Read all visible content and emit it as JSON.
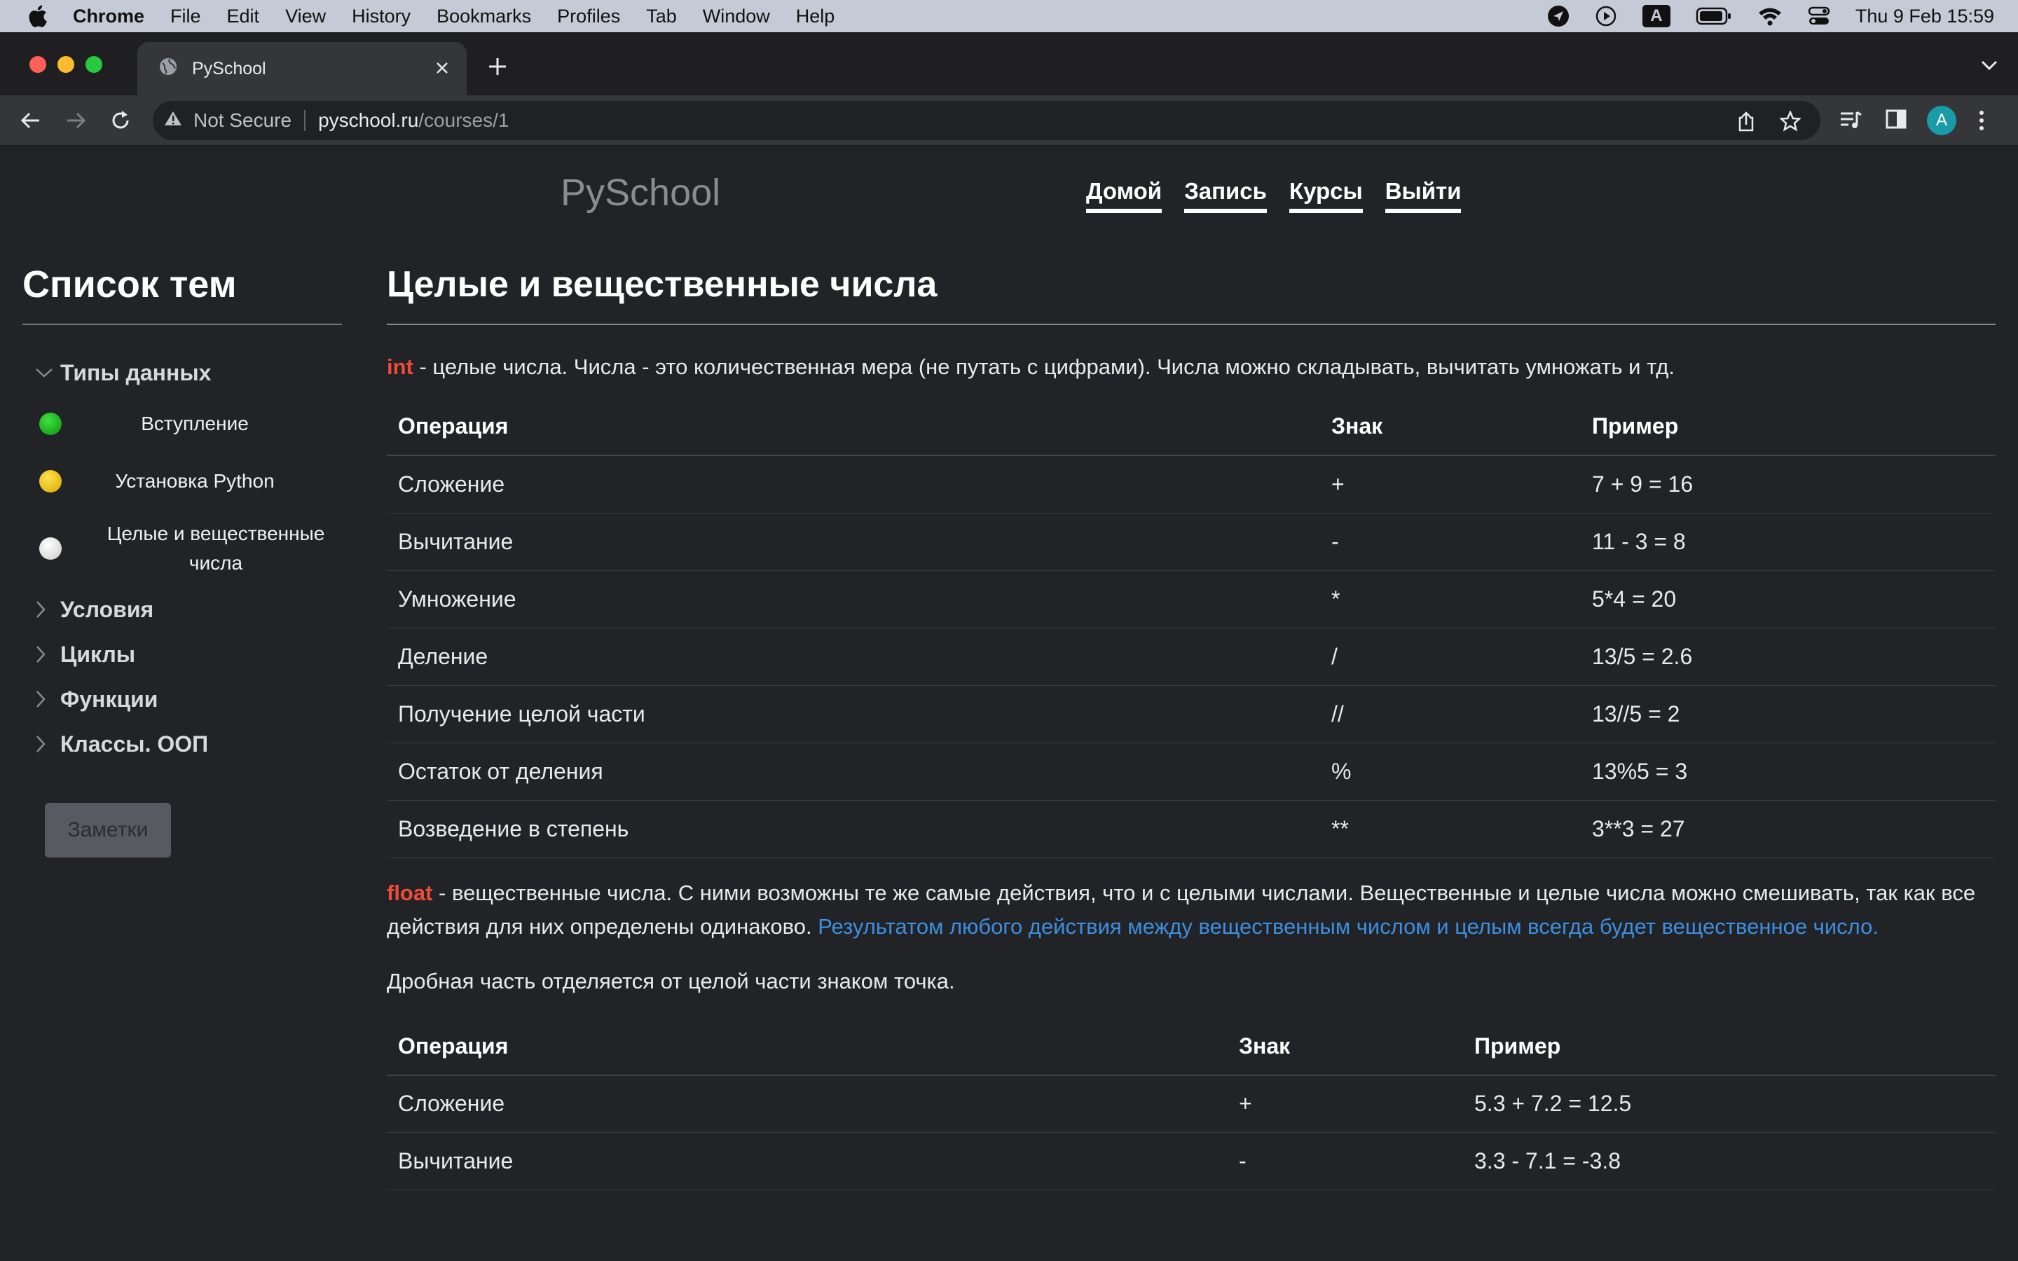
{
  "menubar": {
    "app": "Chrome",
    "items": [
      "File",
      "Edit",
      "View",
      "History",
      "Bookmarks",
      "Profiles",
      "Tab",
      "Window",
      "Help"
    ],
    "clock": "Thu 9 Feb  15:59",
    "input_indicator": "A"
  },
  "browser": {
    "tab_title": "PySchool",
    "security_label": "Not Secure",
    "url_host": "pyschool.ru",
    "url_path": "/courses/1",
    "avatar_letter": "A"
  },
  "site": {
    "brand": "PySchool",
    "nav": [
      "Домой",
      "Запись",
      "Курсы",
      "Выйти"
    ]
  },
  "sidebar": {
    "title": "Список тем",
    "groups": [
      {
        "label": "Типы данных",
        "expanded": true
      },
      {
        "label": "Условия"
      },
      {
        "label": "Циклы"
      },
      {
        "label": "Функции"
      },
      {
        "label": "Классы. ООП"
      }
    ],
    "lessons": [
      {
        "label": "Вступление",
        "status_color": "#1db31d"
      },
      {
        "label": "Установка Python",
        "status_color": "#f6c800"
      },
      {
        "label": "Целые и вещественные числа",
        "status_color": "#e6e6e6"
      }
    ],
    "notes_button": "Заметки"
  },
  "content": {
    "title": "Целые и вещественные числа",
    "int_keyword": "int",
    "int_text": " - целые числа. Числа - это количественная мера (не путать с цифрами). Числа можно складывать, вычитать умножать и тд.",
    "table_headers": [
      "Операция",
      "Знак",
      "Пример"
    ],
    "int_table": [
      [
        "Сложение",
        "+",
        "7 + 9 = 16"
      ],
      [
        "Вычитание",
        "-",
        "11 - 3 = 8"
      ],
      [
        "Умножение",
        "*",
        "5*4 = 20"
      ],
      [
        "Деление",
        "/",
        "13/5 = 2.6"
      ],
      [
        "Получение целой части",
        "//",
        "13//5 = 2"
      ],
      [
        "Остаток от деления",
        "%",
        "13%5 = 3"
      ],
      [
        "Возведение в степень",
        "**",
        "3**3 = 27"
      ]
    ],
    "float_keyword": "float",
    "float_text": " - вещественные числа. С ними возможны те же самые действия, что и с целыми числами. Вещественные и целые числа можно смешивать, так как все действия для них определены одинаково. ",
    "float_highlight": "Результатом любого действия между вещественным числом и целым всегда будет вещественное число.",
    "fraction_text": "Дробная часть отделяется от целой части знаком точка.",
    "float_table": [
      [
        "Сложение",
        "+",
        "5.3 + 7.2 = 12.5"
      ],
      [
        "Вычитание",
        "-",
        "3.3 - 7.1 = -3.8"
      ]
    ]
  }
}
